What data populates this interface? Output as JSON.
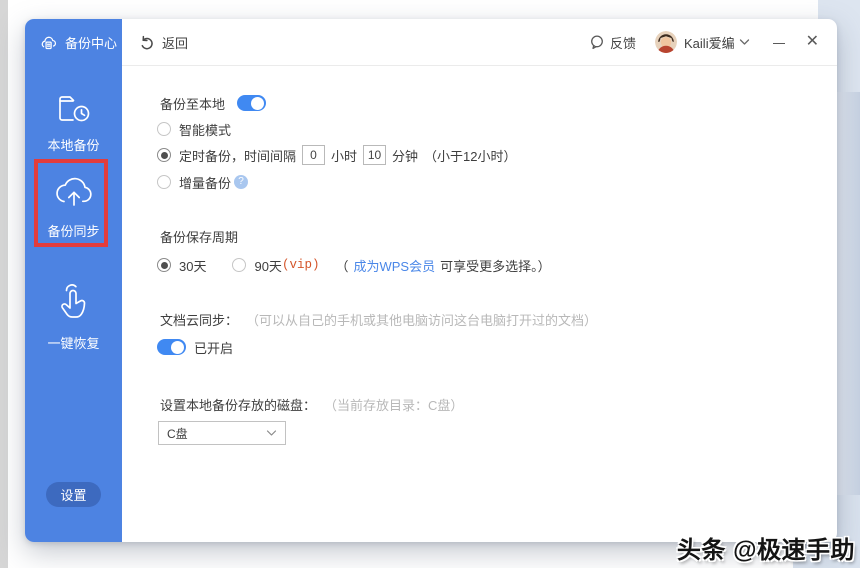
{
  "topbar": {
    "back": "返回",
    "feedback": "反馈",
    "username": "Kaili爱编",
    "close_glyph": "✕"
  },
  "sidebar": {
    "header": "备份中心",
    "items": [
      {
        "label": "本地备份"
      },
      {
        "label": "备份同步",
        "highlighted": true
      },
      {
        "label": "一键恢复"
      }
    ],
    "settings": "设置"
  },
  "main": {
    "backup_local_title": "备份至本地",
    "backup_local_toggle_on": true,
    "mode_smart": "智能模式",
    "mode_timed": "定时备份，时间间隔",
    "hours_value": "0",
    "hours_unit": "小时",
    "minutes_value": "10",
    "minutes_unit": "分钟",
    "timed_hint": "（小于12小时）",
    "mode_incremental": "增量备份",
    "help_glyph": "?",
    "selected_mode": "定时备份",
    "retention_title": "备份保存周期",
    "retention_30": "30天",
    "retention_90": "90天",
    "retention_90_vip": "(vip)",
    "retention_selected": "30天",
    "promo_open": "（",
    "promo_link": "成为WPS会员",
    "promo_rest": "可享受更多选择。）",
    "cloud_sync_title": "文档云同步：",
    "cloud_sync_note": "（可以从自己的手机或其他电脑访问这台电脑打开过的文档）",
    "cloud_sync_state": "已开启",
    "cloud_sync_toggle_on": true,
    "disk_title": "设置本地备份存放的磁盘：",
    "disk_note": "（当前存放目录：C盘）",
    "disk_selected": "C盘"
  },
  "watermark": "头条 @极速手助",
  "colors": {
    "sidebar_blue": "#4d83e2",
    "settings_pill_blue": "#3d6abf",
    "highlight_red": "#e23c3c",
    "toggle_blue": "#4089f2",
    "link_blue": "#4a87e8",
    "vip_orange": "#d4552a",
    "note_gray": "#b8b8b8"
  }
}
